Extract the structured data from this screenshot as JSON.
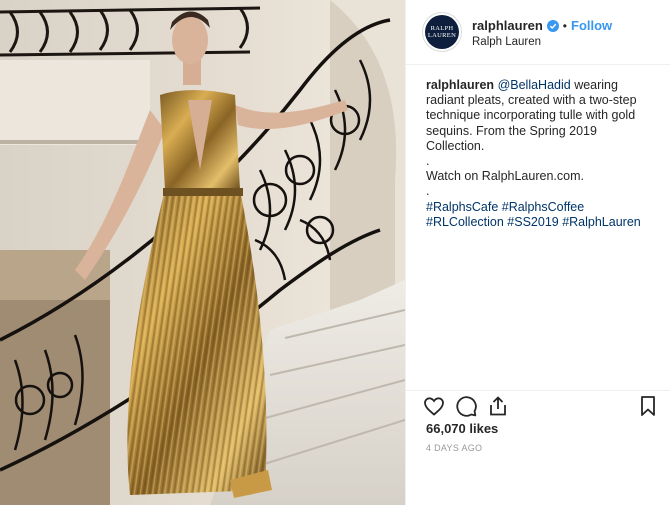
{
  "post": {
    "image_alt": "Model in gold sequin pleated gown on a marble staircase with wrought-iron railing"
  },
  "header": {
    "avatar_text_line1": "RALPH",
    "avatar_text_line2": "LAUREN",
    "username": "ralphlauren",
    "separator": "•",
    "follow_label": "Follow",
    "full_name": "Ralph Lauren",
    "verified_icon": "verified-badge-icon",
    "accent_color": "#3897f0"
  },
  "caption": {
    "username": "ralphlauren",
    "mention": "@BellaHadid",
    "text1": " wearing radiant pleats, created with a two-step technique incorporating tulle with gold sequins. From the Spring 2019 Collection.",
    "dot1": ".",
    "watch": "Watch on RalphLauren.com.",
    "dot2": ".",
    "tags_line1": "#RalphsCafe #RalphsCoffee",
    "tags_line2": "#RLCollection #SS2019 #RalphLauren"
  },
  "actions": {
    "like_icon": "heart-icon",
    "comment_icon": "comment-icon",
    "share_icon": "share-icon",
    "save_icon": "bookmark-icon"
  },
  "stats": {
    "likes": "66,070 likes",
    "date": "4 DAYS AGO"
  }
}
